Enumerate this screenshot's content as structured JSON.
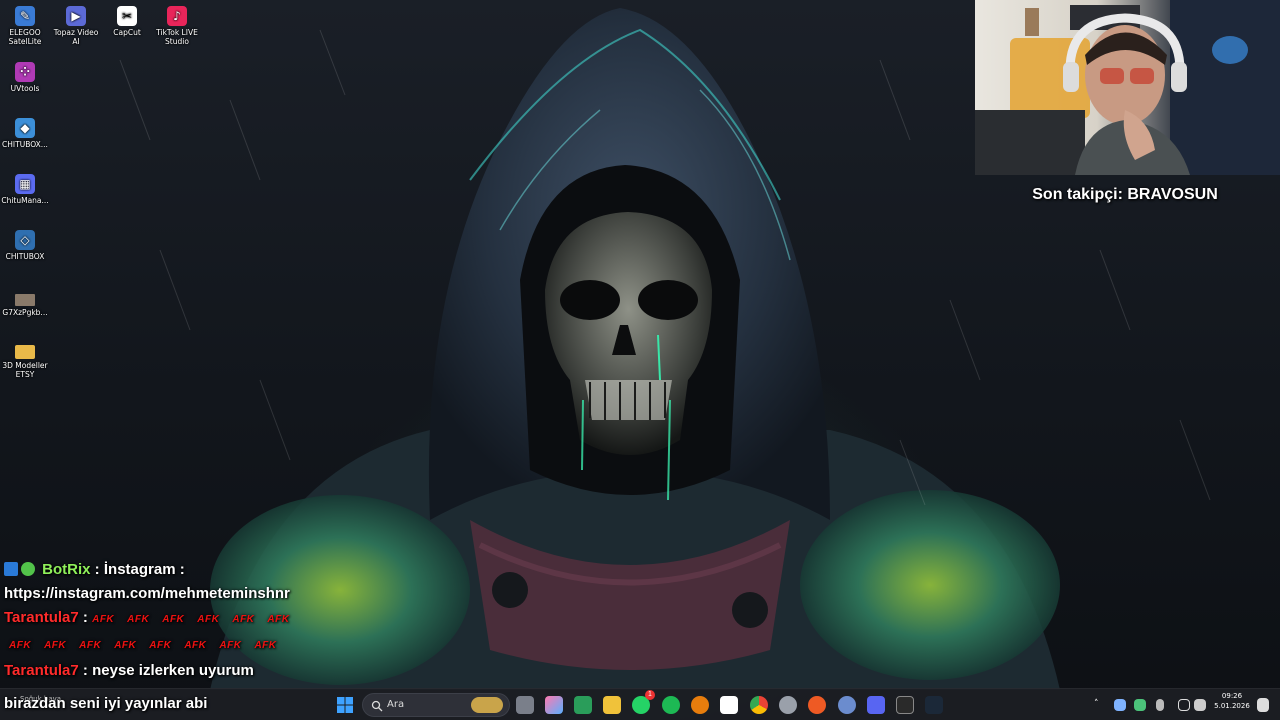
{
  "desktop": {
    "icons": [
      {
        "label": "ELEGOO SatelLite",
        "icon": "elegoo-icon",
        "color": "#3a7bd5"
      },
      {
        "label": "Topaz Video AI",
        "icon": "topaz-icon",
        "color": "#5c6ad6"
      },
      {
        "label": "CapCut",
        "icon": "capcut-icon",
        "color": "#ffffff"
      },
      {
        "label": "TikTok LIVE Studio",
        "icon": "tiktok-live-icon",
        "color": "#e8255a"
      },
      {
        "label": "UVtools",
        "icon": "uvtools-icon",
        "color": "#b03ab5"
      },
      {
        "label": "CHITUBOX...",
        "icon": "chitubox-icon",
        "color": "#3c8fd8"
      },
      {
        "label": "ChituMana...",
        "icon": "chitumanager-icon",
        "color": "#5b6bf0"
      },
      {
        "label": "CHITUBOX",
        "icon": "chitubox-icon",
        "color": "#2f6fb0"
      },
      {
        "label": "G7XzPgkb...",
        "icon": "image-file-icon",
        "color": "#8a7a6a"
      },
      {
        "label": "3D Modeller ETSY",
        "icon": "folder-icon",
        "color": "#e9b949"
      }
    ]
  },
  "overlay": {
    "follower": "Son takipçi: BRAVOSUN"
  },
  "chat": {
    "messages": [
      {
        "user": "BotRix",
        "sep": " : ",
        "text": "İnstagram :"
      },
      {
        "text": "https://instagram.com/mehmeteminshnr"
      },
      {
        "user": "Tarantula7",
        "sep": " : ",
        "afk": [
          "AFK",
          "AFK",
          "AFK",
          "AFK",
          "AFK",
          "AFK"
        ]
      },
      {
        "afk": [
          "AFK",
          "AFK",
          "AFK",
          "AFK",
          "AFK",
          "AFK",
          "AFK",
          "AFK"
        ]
      },
      {
        "user": "Tarantula7",
        "sep": " : ",
        "text": "neyse izlerken uyurum"
      },
      {
        "text": "birazdan seni iyi yayınlar abi"
      }
    ]
  },
  "taskbar": {
    "weather_text": "Soğuk hava",
    "search_placeholder": "Ara",
    "whatsapp_badge": "1",
    "clock_time": "09:26",
    "clock_date": "5.01.2026"
  },
  "colors": {
    "accent_green": "#8ff05a",
    "chat_red": "#ff2b2b",
    "taskbar_bg": "#1c1e24"
  }
}
